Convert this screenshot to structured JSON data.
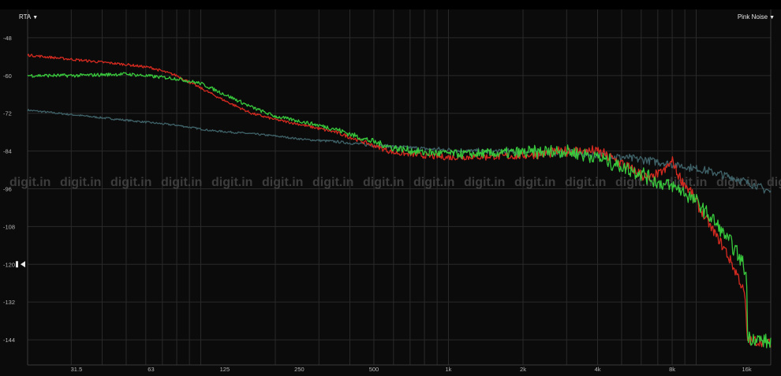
{
  "header": {
    "mode_label": "RTA",
    "signal_label": "Pink Noise",
    "dropdown_icon": "triangle-down-icon"
  },
  "watermark": "digit.in",
  "colors": {
    "background": "#0b0b0b",
    "grid": "#2a2a2a",
    "tick_text": "#b5b5b5",
    "series_red": "#d42a20",
    "series_green": "#38c93c",
    "series_slate": "#3f6268"
  },
  "chart_data": {
    "type": "line",
    "x_scale": "log",
    "xlim": [
      20,
      20000
    ],
    "ylim": [
      -152,
      -39
    ],
    "grid": true,
    "x_tick_labels": [
      {
        "value": 31.5,
        "label": "31.5"
      },
      {
        "value": 63,
        "label": "63"
      },
      {
        "value": 125,
        "label": "125"
      },
      {
        "value": 250,
        "label": "250"
      },
      {
        "value": 500,
        "label": "500"
      },
      {
        "value": 1000,
        "label": "1k"
      },
      {
        "value": 2000,
        "label": "2k"
      },
      {
        "value": 4000,
        "label": "4k"
      },
      {
        "value": 8000,
        "label": "8k"
      },
      {
        "value": 16000,
        "label": "16k"
      }
    ],
    "y_tick_labels": [
      {
        "value": -48,
        "label": "-48"
      },
      {
        "value": -60,
        "label": "-60"
      },
      {
        "value": -72,
        "label": "-72"
      },
      {
        "value": -84,
        "label": "-84"
      },
      {
        "value": -96,
        "label": "-96"
      },
      {
        "value": -108,
        "label": "-108"
      },
      {
        "value": -120,
        "label": "-120"
      },
      {
        "value": -132,
        "label": "-132"
      },
      {
        "value": -144,
        "label": "-144"
      }
    ],
    "reference_level": -120,
    "series": [
      {
        "color": "#3f6268",
        "noise": 0.6,
        "points": [
          [
            20,
            -71
          ],
          [
            31.5,
            -72.6
          ],
          [
            50,
            -74.2
          ],
          [
            80,
            -75.8
          ],
          [
            110,
            -77.5
          ],
          [
            160,
            -78.5
          ],
          [
            200,
            -79.2
          ],
          [
            260,
            -80.3
          ],
          [
            350,
            -81
          ],
          [
            500,
            -82.2
          ],
          [
            800,
            -83.3
          ],
          [
            1200,
            -84
          ],
          [
            2000,
            -84.3
          ],
          [
            3000,
            -84.7
          ],
          [
            4000,
            -85.1
          ],
          [
            5000,
            -86
          ],
          [
            6500,
            -87
          ],
          [
            8000,
            -88.2
          ],
          [
            11000,
            -90.2
          ],
          [
            14000,
            -92.4
          ],
          [
            17000,
            -94.6
          ],
          [
            20000,
            -97
          ]
        ]
      },
      {
        "color": "#d42a20",
        "noise": 0.8,
        "points": [
          [
            20,
            -53.5
          ],
          [
            31.5,
            -55
          ],
          [
            50,
            -56.5
          ],
          [
            63,
            -57.5
          ],
          [
            80,
            -60
          ],
          [
            100,
            -64
          ],
          [
            125,
            -68
          ],
          [
            160,
            -72
          ],
          [
            200,
            -74
          ],
          [
            250,
            -75.5
          ],
          [
            350,
            -78
          ],
          [
            450,
            -81
          ],
          [
            600,
            -84.5
          ],
          [
            800,
            -85.5
          ],
          [
            1000,
            -86
          ],
          [
            2000,
            -85.5
          ],
          [
            3000,
            -84
          ],
          [
            4000,
            -84
          ],
          [
            5000,
            -88
          ],
          [
            6500,
            -93
          ],
          [
            7500,
            -90
          ],
          [
            8000,
            -87
          ],
          [
            8500,
            -92
          ],
          [
            9500,
            -97
          ],
          [
            11000,
            -106
          ],
          [
            13000,
            -115
          ],
          [
            15000,
            -125
          ],
          [
            15800,
            -131
          ],
          [
            16050,
            -144
          ],
          [
            18000,
            -144.5
          ],
          [
            20000,
            -145
          ]
        ]
      },
      {
        "color": "#38c93c",
        "noise": 1.1,
        "points": [
          [
            20,
            -60
          ],
          [
            31.5,
            -60
          ],
          [
            50,
            -59.5
          ],
          [
            80,
            -61
          ],
          [
            100,
            -62.5
          ],
          [
            125,
            -66
          ],
          [
            160,
            -70
          ],
          [
            200,
            -73
          ],
          [
            250,
            -74.5
          ],
          [
            350,
            -77
          ],
          [
            450,
            -80
          ],
          [
            600,
            -83
          ],
          [
            800,
            -84.5
          ],
          [
            1200,
            -85
          ],
          [
            2000,
            -84.5
          ],
          [
            3000,
            -84
          ],
          [
            4000,
            -86
          ],
          [
            5000,
            -89
          ],
          [
            6000,
            -91
          ],
          [
            7000,
            -94
          ],
          [
            8500,
            -96
          ],
          [
            10000,
            -100
          ],
          [
            12000,
            -107
          ],
          [
            14000,
            -114
          ],
          [
            15500,
            -120
          ],
          [
            16000,
            -124
          ],
          [
            16050,
            -143
          ],
          [
            18000,
            -144
          ],
          [
            20000,
            -145
          ]
        ]
      }
    ]
  }
}
